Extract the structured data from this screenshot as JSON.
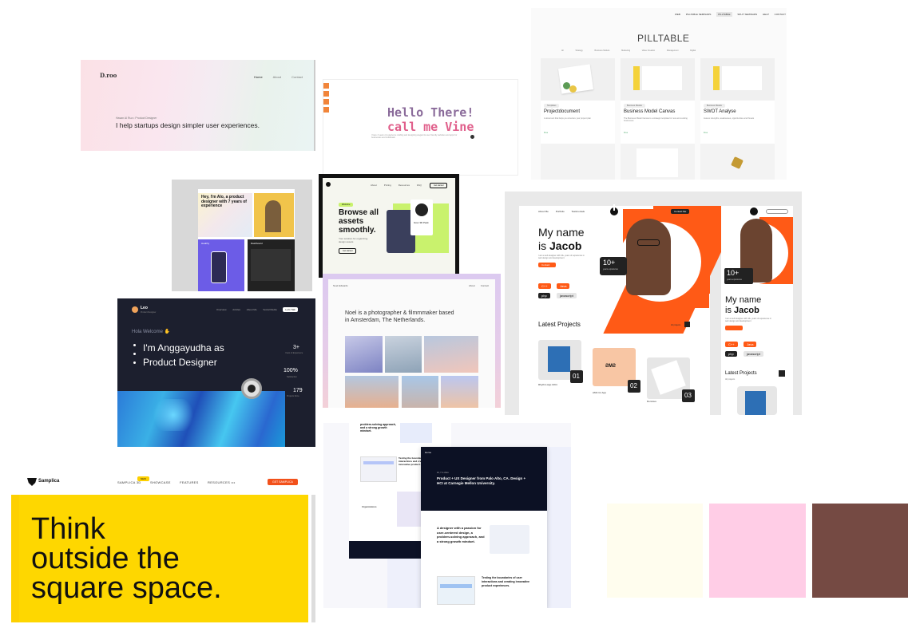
{
  "items": {
    "product_card": {
      "logo": "D.roo",
      "nav": [
        "Home",
        "About",
        "Contact"
      ],
      "subtitle": "Hasan Al Ruz • Product Designer",
      "headline": "I help startups design simpler user experiences."
    },
    "vine": {
      "headline1": "Hello There!",
      "headline2": "call me Vine",
      "sub": "I have 4 years of experience crafting and designing elegant & user-friendly websites and apps for businesses and individuals"
    },
    "pilltable": {
      "nav": [
        "WEB",
        "PILLTABLE SEMINARS",
        "PILLTABLE",
        "SPLIT SEMINARS",
        "HELP",
        "CONTACT"
      ],
      "title": "PILLTABLE",
      "filters": [
        "All",
        "Strategy",
        "Business Models",
        "Marketing",
        "Value Creation",
        "Management",
        "Digital"
      ],
      "cards": [
        {
          "tag": "Templates",
          "title": "Projectdocument",
          "desc": "A document that helps you structure your project plan",
          "meta": "Free"
        },
        {
          "tag": "Business Models",
          "title": "Business Model Canvas",
          "desc": "The Business Model Canvas is a strategic template for new and existing businesses",
          "meta": "Free"
        },
        {
          "tag": "Business Models",
          "title": "SWOT Analyse",
          "desc": "Assess strengths, weaknesses, opportunities and threats",
          "meta": "Free"
        }
      ]
    },
    "alo": {
      "headline": "Hey, I'm Alo, a product designer with 7 years of experience",
      "card1": "Healthy",
      "card2": "Dashboard"
    },
    "browse": {
      "badge": "Welcome",
      "headline1": "Browse all",
      "headline2": "assets",
      "headline3": "smoothly.",
      "sub": "Your solution for organizing design assets",
      "nav": [
        "About",
        "Pricing",
        "Resources",
        "FAQ"
      ],
      "cta": "Get started",
      "product": "Grec 3D Pack"
    },
    "jacob": {
      "nav": [
        "About Me",
        "Portfolio",
        "Testimonials"
      ],
      "contact": "Contact Me",
      "headline1": "My name",
      "headline2": "is ",
      "name": "Jacob",
      "desc": "I am a web designer with 10+ years of experience in web design and development",
      "btn": "Contact",
      "exp": "10+",
      "exp_sub": "years experience",
      "tags": [
        "C++",
        "Java",
        "php",
        "javascript"
      ],
      "latest": "Latest Projects",
      "all": "All projects",
      "projects": [
        {
          "num": "01",
          "label": "Rhythm App UIKit"
        },
        {
          "num": "02",
          "label": "AMC for App"
        },
        {
          "num": "03",
          "label": "Dominus"
        }
      ],
      "mobile_headline1": "My name",
      "mobile_headline2": "is ",
      "mobile_latest": "Latest Projects",
      "mobile_sub": "All projects"
    },
    "leo": {
      "logo": "Leo",
      "logo_sub": "Product Designer",
      "nav": [
        "Overview",
        "Articles",
        "About Me",
        "Social Media",
        "Let's Talk"
      ],
      "welcome": "Hola Welcome",
      "headline1": "I'm Anggayudha as",
      "headline2": "Product Designer",
      "stat1": "3+",
      "stat1_label": "Years of Experience",
      "stat2": "100%",
      "stat2_label": "Satisfaction",
      "stat3": "179",
      "stat3_label": "Projects Done"
    },
    "noel": {
      "logo": "Noel Edwards",
      "nav": [
        "About",
        "Contact"
      ],
      "headline": "Noel is a photographer & filmmmaker based in Amsterdam, The Netherlands."
    },
    "samplica": {
      "logo": "Samplica",
      "nav": [
        "SAMPLICA 3D",
        "SHOWCASE",
        "FEATURES",
        "RESOURCES •••"
      ],
      "badge": "NEW",
      "cta": "GET SAMPLICA",
      "headline1": "Think",
      "headline2": "outside the",
      "headline3": "square space."
    },
    "product_designer": {
      "top_text": "problem-solving approach, and a strong growth mindset.",
      "text2": "Testing the boundaries of user interactions and creating innovative product experiences.",
      "text3": "Organizations",
      "dark_nav": "Home",
      "dark_intro": "Hi, I'm Alex",
      "dark_headline": "Product + UX Designer from Palo Alto, CA. Design + HCI at Carnegie Mellon University.",
      "section1": "A designer with a passion for user-centered design, a problem-solving approach, and a strong growth mindset.",
      "section2": "Testing the boundaries of user interactions and creating innovative product experiences."
    },
    "palette": {
      "colors": [
        "#fffdee",
        "#ffcde6",
        "#754a43"
      ]
    }
  }
}
